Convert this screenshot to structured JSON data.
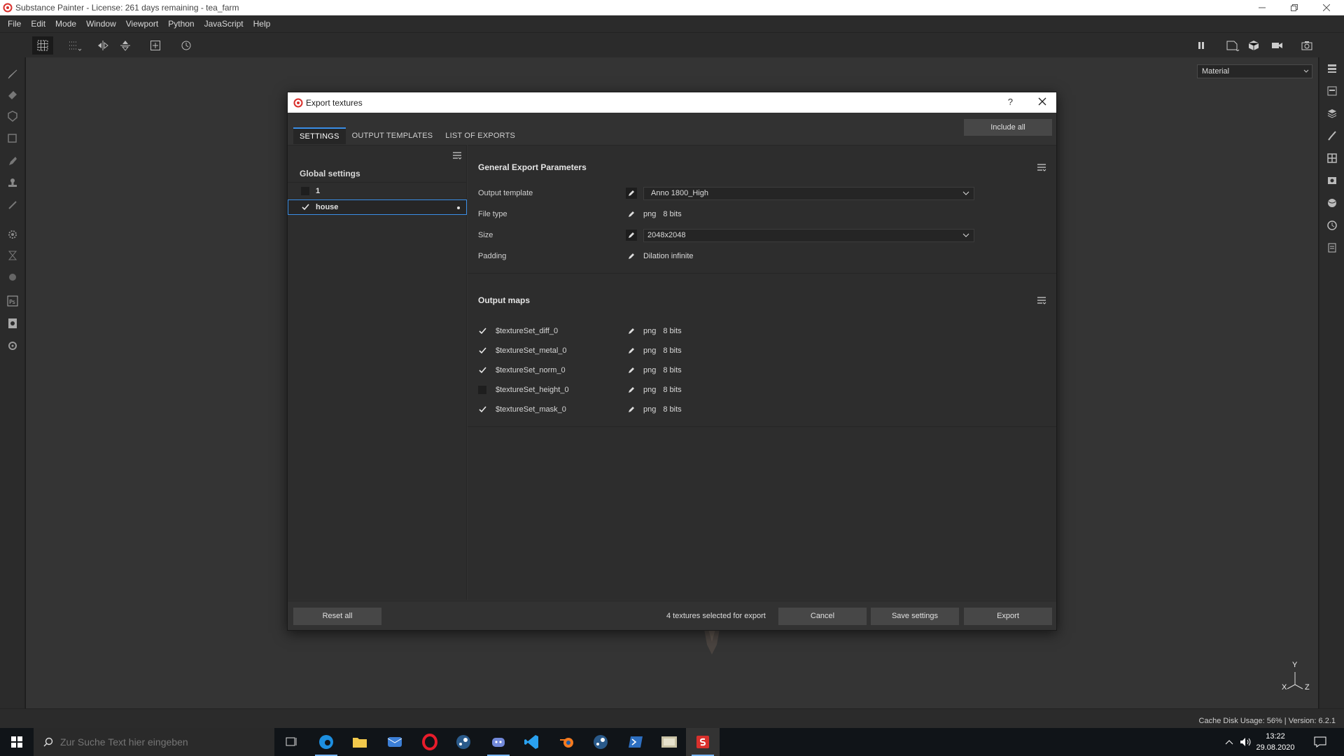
{
  "app": {
    "title": "Substance Painter - License: 261 days remaining - tea_farm"
  },
  "menu": [
    "File",
    "Edit",
    "Mode",
    "Window",
    "Viewport",
    "Python",
    "JavaScript",
    "Help"
  ],
  "viewport": {
    "material_select": "Material",
    "axis": {
      "x": "X",
      "y": "Y",
      "z": "Z"
    }
  },
  "status": {
    "text": "Cache Disk Usage:   56% | Version: 6.2.1"
  },
  "dialog": {
    "title": "Export textures",
    "help": "?",
    "tabs": [
      "SETTINGS",
      "OUTPUT TEMPLATES",
      "LIST OF EXPORTS"
    ],
    "active_tab": 0,
    "include_all": "Include all",
    "texture_sets": {
      "header": "Global settings",
      "items": [
        {
          "label": "1",
          "checked": false
        },
        {
          "label": "house",
          "checked": true
        }
      ]
    },
    "general": {
      "header": "General Export Parameters",
      "output_template_label": "Output template",
      "output_template_value": "Anno 1800_High",
      "file_type_label": "File type",
      "file_type_format": "png",
      "file_type_bits": "8 bits",
      "size_label": "Size",
      "size_value": "2048x2048",
      "padding_label": "Padding",
      "padding_value": "Dilation infinite"
    },
    "output_maps": {
      "header": "Output maps",
      "items": [
        {
          "name": "$textureSet_diff_0",
          "checked": true,
          "format": "png",
          "bits": "8 bits"
        },
        {
          "name": "$textureSet_metal_0",
          "checked": true,
          "format": "png",
          "bits": "8 bits"
        },
        {
          "name": "$textureSet_norm_0",
          "checked": true,
          "format": "png",
          "bits": "8 bits"
        },
        {
          "name": "$textureSet_height_0",
          "checked": false,
          "format": "png",
          "bits": "8 bits"
        },
        {
          "name": "$textureSet_mask_0",
          "checked": true,
          "format": "png",
          "bits": "8 bits"
        }
      ]
    },
    "footer": {
      "reset_all": "Reset all",
      "selection_count": "4 textures selected for export",
      "cancel": "Cancel",
      "save_settings": "Save settings",
      "export": "Export"
    }
  },
  "taskbar": {
    "search_placeholder": "Zur Suche Text hier eingeben",
    "time": "13:22",
    "date": "29.08.2020"
  },
  "colors": {
    "accent": "#3a8ee6",
    "logo_red": "#d9302c"
  }
}
